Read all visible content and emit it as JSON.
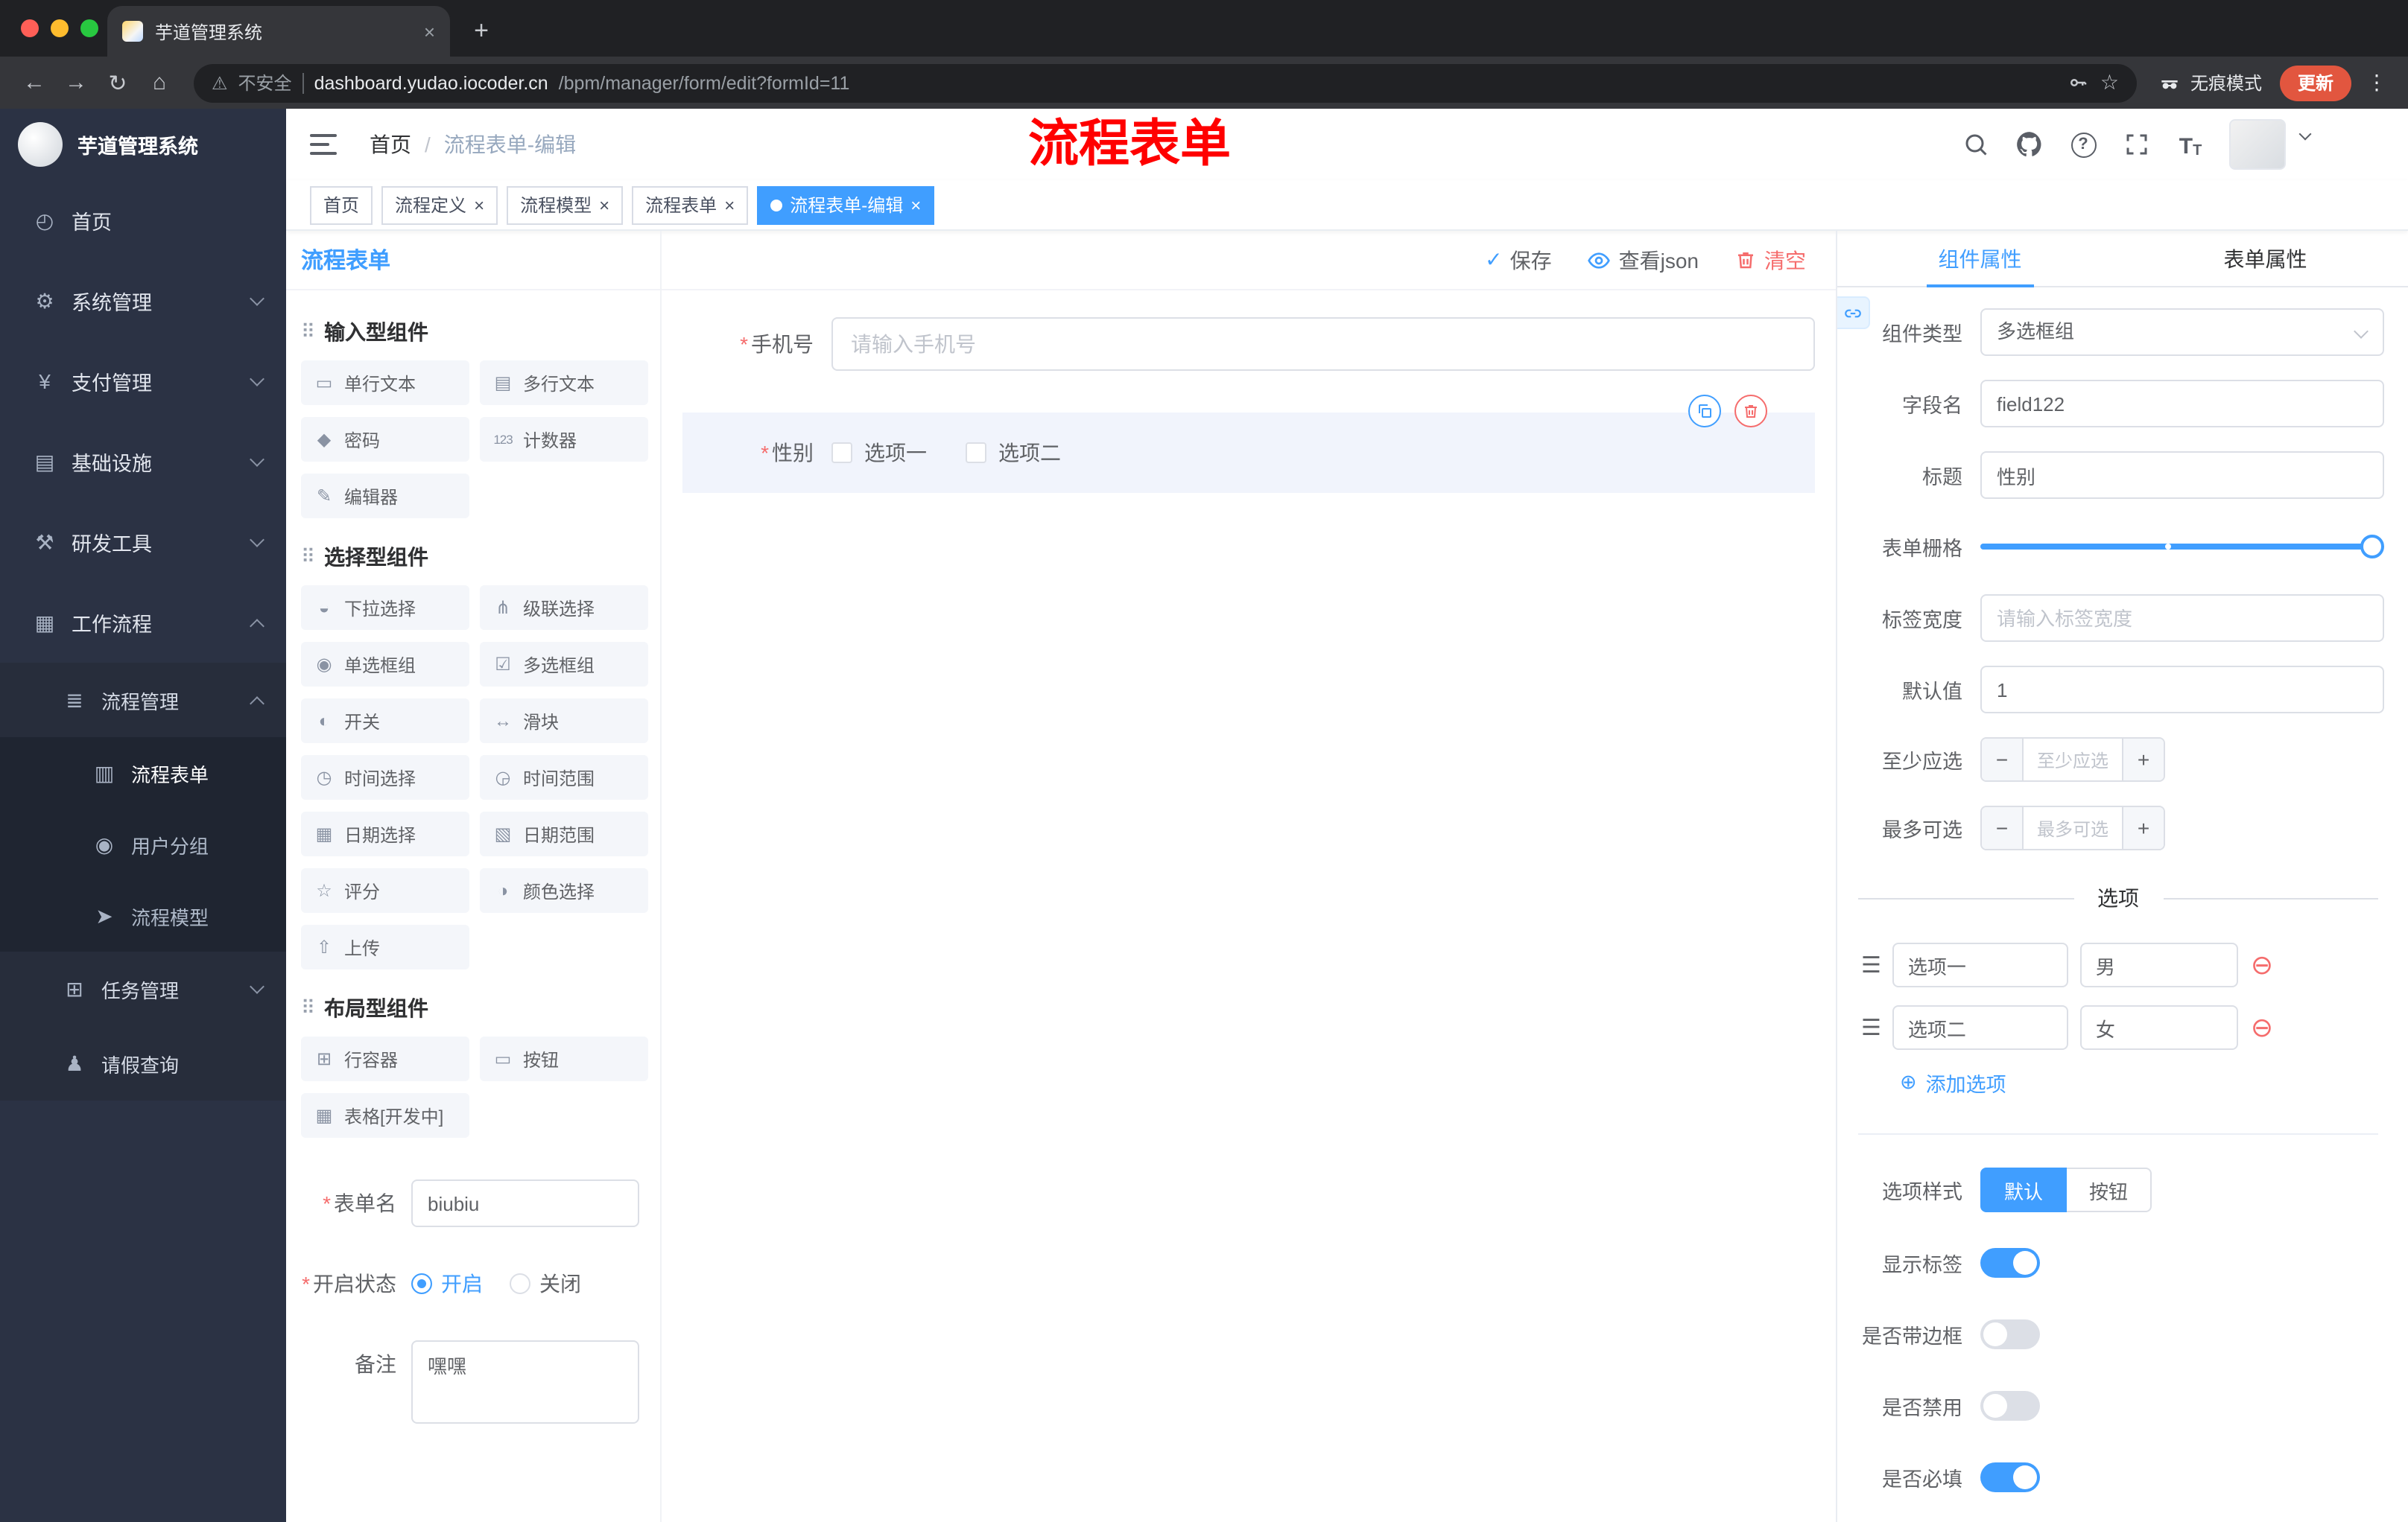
{
  "colors": {
    "accent": "#409eff",
    "danger": "#f56c6c",
    "annotation": "#ff0000",
    "update": "#e2563f"
  },
  "ui": {
    "required": "*"
  },
  "icons": {
    "back": "←",
    "forward": "→",
    "refresh": "↻",
    "home": "⌂",
    "warning": "⚠",
    "star": "☆",
    "close": "×",
    "plus": "+",
    "kebab": "⋮",
    "check": "✓",
    "question": "?",
    "font": "T",
    "grip": "⠿",
    "tune": "☰",
    "minus": "−",
    "plus_circle": "⊕",
    "minus_circle": "⊖"
  },
  "browser": {
    "tab": {
      "title": "芋道管理系统"
    },
    "omnibox": {
      "security": "不安全",
      "domain": "dashboard.yudao.iocoder.cn",
      "path": "/bpm/manager/form/edit?formId=11"
    },
    "incognito": "无痕模式",
    "update": "更新"
  },
  "sidebar": {
    "title": "芋道管理系统",
    "items": [
      {
        "icon": "◴",
        "label": "首页"
      },
      {
        "icon": "⚙",
        "label": "系统管理"
      },
      {
        "icon": "¥",
        "label": "支付管理"
      },
      {
        "icon": "▤",
        "label": "基础设施"
      },
      {
        "icon": "⚒",
        "label": "研发工具"
      },
      {
        "icon": "▦",
        "label": "工作流程"
      },
      {
        "icon": "≣",
        "label": "流程管理"
      },
      {
        "icon": "▥",
        "label": "流程表单"
      },
      {
        "icon": "◉",
        "label": "用户分组"
      },
      {
        "icon": "➤",
        "label": "流程模型"
      },
      {
        "icon": "⊞",
        "label": "任务管理"
      },
      {
        "icon": "♟",
        "label": "请假查询"
      }
    ]
  },
  "header": {
    "breadcrumb_home": "首页",
    "breadcrumb_sep": "/",
    "breadcrumb_current": "流程表单-编辑",
    "annotation": "流程表单"
  },
  "tags": [
    {
      "label": "首页"
    },
    {
      "label": "流程定义"
    },
    {
      "label": "流程模型"
    },
    {
      "label": "流程表单"
    },
    {
      "label": "流程表单-编辑"
    }
  ],
  "palette": {
    "title": "流程表单",
    "sections": [
      {
        "title": "输入型组件",
        "items": [
          {
            "icon": "▭",
            "label": "单行文本"
          },
          {
            "icon": "▤",
            "label": "多行文本"
          },
          {
            "icon": "◆",
            "label": "密码"
          },
          {
            "icon": "123",
            "label": "计数器"
          },
          {
            "icon": "✎",
            "label": "编辑器"
          }
        ]
      },
      {
        "title": "选择型组件",
        "items": [
          {
            "icon": "◒",
            "label": "下拉选择"
          },
          {
            "icon": "⋔",
            "label": "级联选择"
          },
          {
            "icon": "◉",
            "label": "单选框组"
          },
          {
            "icon": "☑",
            "label": "多选框组"
          },
          {
            "icon": "◐",
            "label": "开关"
          },
          {
            "icon": "↔",
            "label": "滑块"
          },
          {
            "icon": "◷",
            "label": "时间选择"
          },
          {
            "icon": "◶",
            "label": "时间范围"
          },
          {
            "icon": "▦",
            "label": "日期选择"
          },
          {
            "icon": "▧",
            "label": "日期范围"
          },
          {
            "icon": "☆",
            "label": "评分"
          },
          {
            "icon": "◑",
            "label": "颜色选择"
          },
          {
            "icon": "⇧",
            "label": "上传"
          }
        ]
      },
      {
        "title": "布局型组件",
        "items": [
          {
            "icon": "⊞",
            "label": "行容器"
          },
          {
            "icon": "▭",
            "label": "按钮"
          },
          {
            "icon": "▦",
            "label": "表格[开发中]"
          }
        ]
      }
    ],
    "form": {
      "name_label": "表单名",
      "name_value": "biubiu",
      "status_label": "开启状态",
      "status_on": "开启",
      "status_off": "关闭",
      "remark_label": "备注",
      "remark_value": "嘿嘿"
    }
  },
  "canvas": {
    "actions": {
      "save": "保存",
      "view_json": "查看json",
      "clear": "清空"
    },
    "phone": {
      "label": "手机号",
      "placeholder": "请输入手机号"
    },
    "gender": {
      "label": "性别",
      "option1": "选项一",
      "option2": "选项二"
    }
  },
  "inspector": {
    "tab_component": "组件属性",
    "tab_form": "表单属性",
    "rows": {
      "type_label": "组件类型",
      "type_value": "多选框组",
      "field_label": "字段名",
      "field_value": "field122",
      "title_label": "标题",
      "title_value": "性别",
      "grid_label": "表单栅格",
      "labelwidth_label": "标签宽度",
      "labelwidth_placeholder": "请输入标签宽度",
      "default_label": "默认值",
      "default_value": "1",
      "min_label": "至少应选",
      "min_placeholder": "至少应选",
      "max_label": "最多可选",
      "max_placeholder": "最多可选"
    },
    "options_title": "选项",
    "options": [
      {
        "label": "选项一",
        "value": "男"
      },
      {
        "label": "选项二",
        "value": "女"
      }
    ],
    "add_option": "添加选项",
    "style_label": "选项样式",
    "style_default": "默认",
    "style_button": "按钮",
    "switches": {
      "show_label": "显示标签",
      "border": "是否带边框",
      "disabled": "是否禁用",
      "required": "是否必填"
    }
  }
}
